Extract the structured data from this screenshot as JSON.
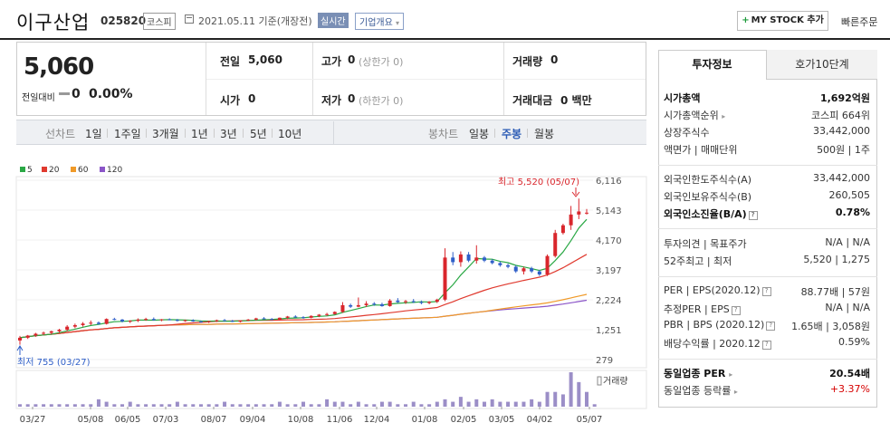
{
  "header": {
    "company": "이구산업",
    "code": "025820",
    "market": "코스피",
    "date": "2021.05.11 기준(개장전)",
    "realtime": "실시간",
    "overview": "기업개요",
    "mystock": "MY STOCK 추가",
    "quick_order": "빠른주문"
  },
  "price": {
    "current": "5,060",
    "change_label": "전일대비",
    "change": "0",
    "change_rate": "0.00%"
  },
  "quote": {
    "prev_label": "전일",
    "prev": "5,060",
    "high_label": "고가",
    "high": "0",
    "high_sub": "(상한가 0)",
    "volume_label": "거래량",
    "volume": "0",
    "open_label": "시가",
    "open": "0",
    "low_label": "저가",
    "low": "0",
    "low_sub": "(하한가 0)",
    "amount_label": "거래대금",
    "amount": "0 백만"
  },
  "periods": {
    "line_label": "선차트",
    "items": [
      "1일",
      "1주일",
      "3개월",
      "1년",
      "3년",
      "5년",
      "10년"
    ],
    "candle_label": "봉차트",
    "candle_items": [
      "일봉",
      "주봉",
      "월봉"
    ],
    "active": "주봉"
  },
  "legend": [
    {
      "label": "5",
      "color": "#2aa845"
    },
    {
      "label": "20",
      "color": "#e03a2f"
    },
    {
      "label": "60",
      "color": "#f09a28"
    },
    {
      "label": "120",
      "color": "#8b55c8"
    }
  ],
  "chart_data": {
    "type": "candlestick",
    "y_ticks": [
      "6,116",
      "5,143",
      "4,170",
      "3,197",
      "2,224",
      "1,251",
      "279"
    ],
    "ylim": [
      279,
      6116
    ],
    "x_ticks": [
      "03/27",
      "05/08",
      "06/05",
      "07/03",
      "08/07",
      "09/04",
      "10/08",
      "11/06",
      "12/04",
      "01/08",
      "02/05",
      "03/05",
      "04/02",
      "05/07"
    ],
    "max_annotation": "최고 5,520 (05/07)",
    "min_annotation": "최저 755 (03/27)",
    "volume_label": "거래량",
    "candles": [
      [
        900,
        1050,
        760,
        990
      ],
      [
        990,
        1080,
        950,
        1060
      ],
      [
        1060,
        1150,
        1020,
        1120
      ],
      [
        1120,
        1190,
        1080,
        1150
      ],
      [
        1150,
        1220,
        1100,
        1200
      ],
      [
        1200,
        1280,
        1150,
        1250
      ],
      [
        1250,
        1400,
        1200,
        1350
      ],
      [
        1350,
        1450,
        1300,
        1400
      ],
      [
        1400,
        1500,
        1350,
        1450
      ],
      [
        1450,
        1550,
        1400,
        1480
      ],
      [
        1480,
        1520,
        1410,
        1440
      ],
      [
        1440,
        1620,
        1420,
        1600
      ],
      [
        1600,
        1640,
        1560,
        1580
      ],
      [
        1580,
        1600,
        1490,
        1520
      ],
      [
        1520,
        1560,
        1470,
        1540
      ],
      [
        1540,
        1620,
        1500,
        1580
      ],
      [
        1580,
        1640,
        1540,
        1600
      ],
      [
        1600,
        1650,
        1550,
        1560
      ],
      [
        1560,
        1600,
        1530,
        1590
      ],
      [
        1590,
        1620,
        1560,
        1570
      ],
      [
        1570,
        1600,
        1520,
        1540
      ],
      [
        1540,
        1580,
        1510,
        1560
      ],
      [
        1560,
        1590,
        1510,
        1520
      ],
      [
        1520,
        1550,
        1480,
        1500
      ],
      [
        1500,
        1540,
        1470,
        1530
      ],
      [
        1530,
        1580,
        1500,
        1560
      ],
      [
        1560,
        1600,
        1530,
        1540
      ],
      [
        1540,
        1570,
        1500,
        1510
      ],
      [
        1510,
        1560,
        1490,
        1550
      ],
      [
        1550,
        1600,
        1530,
        1580
      ],
      [
        1580,
        1640,
        1550,
        1620
      ],
      [
        1620,
        1660,
        1590,
        1600
      ],
      [
        1600,
        1630,
        1560,
        1580
      ],
      [
        1580,
        1650,
        1560,
        1640
      ],
      [
        1640,
        1700,
        1600,
        1680
      ],
      [
        1680,
        1720,
        1640,
        1660
      ],
      [
        1660,
        1690,
        1610,
        1640
      ],
      [
        1640,
        1720,
        1620,
        1700
      ],
      [
        1700,
        1760,
        1660,
        1740
      ],
      [
        1740,
        1800,
        1700,
        1760
      ],
      [
        1760,
        1850,
        1740,
        1830
      ],
      [
        1830,
        2150,
        1800,
        2050
      ],
      [
        2050,
        2100,
        1960,
        2000
      ],
      [
        2000,
        2300,
        1980,
        2050
      ],
      [
        2050,
        2180,
        1990,
        2100
      ],
      [
        2100,
        2150,
        2030,
        2080
      ],
      [
        2080,
        2130,
        2000,
        2020
      ],
      [
        2020,
        2250,
        2000,
        2200
      ],
      [
        2200,
        2280,
        2120,
        2150
      ],
      [
        2150,
        2220,
        2090,
        2180
      ],
      [
        2180,
        2250,
        2120,
        2150
      ],
      [
        2150,
        2200,
        2080,
        2120
      ],
      [
        2120,
        2180,
        2080,
        2160
      ],
      [
        2160,
        2260,
        2120,
        2230
      ],
      [
        2230,
        3900,
        2180,
        3600
      ],
      [
        3600,
        3780,
        3350,
        3450
      ],
      [
        3450,
        3800,
        3300,
        3700
      ],
      [
        3700,
        3780,
        3450,
        3500
      ],
      [
        3500,
        4000,
        3400,
        3600
      ],
      [
        3600,
        3650,
        3450,
        3500
      ],
      [
        3500,
        3550,
        3380,
        3420
      ],
      [
        3420,
        3470,
        3300,
        3350
      ],
      [
        3350,
        3400,
        3250,
        3300
      ],
      [
        3300,
        3350,
        3100,
        3150
      ],
      [
        3150,
        3300,
        3050,
        3250
      ],
      [
        3250,
        3300,
        3100,
        3150
      ],
      [
        3150,
        3200,
        3000,
        3050
      ],
      [
        3050,
        3700,
        3000,
        3650
      ],
      [
        3650,
        4500,
        3600,
        4400
      ],
      [
        4400,
        4700,
        4350,
        4650
      ],
      [
        4650,
        5280,
        4500,
        5000
      ],
      [
        5000,
        5520,
        4850,
        5100
      ],
      [
        5060,
        5180,
        5000,
        5060
      ]
    ],
    "volumes": [
      1,
      1,
      1,
      1,
      1,
      1,
      1,
      1,
      1,
      1,
      3,
      2,
      1,
      1,
      2,
      1,
      1,
      1,
      1,
      1,
      2,
      1,
      1,
      1,
      1,
      1,
      2,
      1,
      1,
      1,
      1,
      1,
      1,
      2,
      1,
      1,
      2,
      1,
      1,
      3,
      2,
      2,
      1,
      2,
      1,
      1,
      2,
      2,
      1,
      1,
      2,
      1,
      1,
      2,
      3,
      2,
      4,
      2,
      3,
      2,
      3,
      2,
      2,
      2,
      2,
      3,
      2,
      6,
      6,
      5,
      14,
      10,
      6,
      1
    ]
  },
  "info": {
    "tab_active": "투자정보",
    "tab_other": "호가10단계",
    "rows": [
      {
        "label": "시가총액",
        "value": "1,692억원",
        "bold": true
      },
      {
        "label": "시가총액순위",
        "value": "코스피 664위"
      },
      {
        "label": "상장주식수",
        "value": "33,442,000"
      },
      {
        "label": "액면가 | 매매단위",
        "value": "500원 | 1주"
      },
      {
        "label": "외국인한도주식수(A)",
        "value": "33,442,000"
      },
      {
        "label": "외국인보유주식수(B)",
        "value": "260,505"
      },
      {
        "label": "외국인소진율(B/A)",
        "value": "0.78%",
        "bold": true
      },
      {
        "label": "투자의견 | 목표주가",
        "value": "N/A | N/A"
      },
      {
        "label": "52주최고 | 최저",
        "value": "5,520 | 1,275"
      },
      {
        "label": "PER | EPS(2020.12)",
        "value": "88.77배 | 57원"
      },
      {
        "label": "추정PER | EPS",
        "value": "N/A | N/A"
      },
      {
        "label": "PBR | BPS (2020.12)",
        "value": "1.65배 | 3,058원"
      },
      {
        "label": "배당수익률 | 2020.12",
        "value": "0.59%"
      },
      {
        "label": "동일업종 PER",
        "value": "20.54배",
        "bold": true
      },
      {
        "label": "동일업종 등락률",
        "value": "+3.37%"
      }
    ]
  }
}
